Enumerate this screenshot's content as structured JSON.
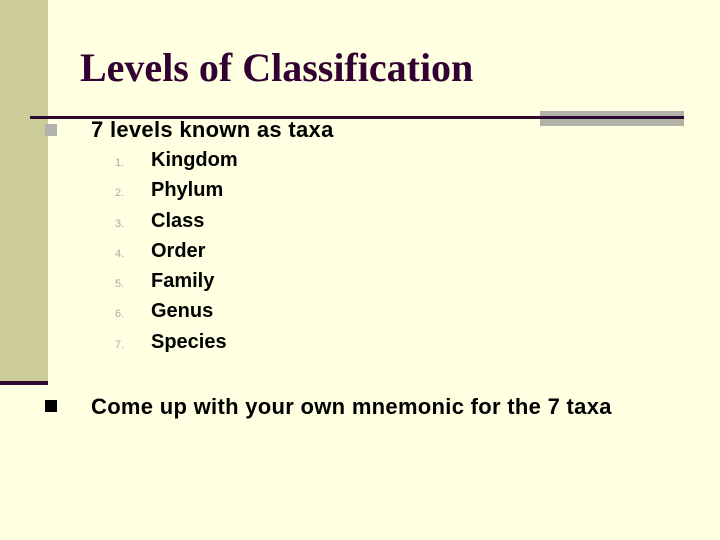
{
  "slide": {
    "title": "Levels of Classification",
    "bullets": [
      {
        "text": "7 levels known as taxa",
        "sub_items": [
          {
            "number": "1.",
            "text": "Kingdom"
          },
          {
            "number": "2.",
            "text": "Phylum"
          },
          {
            "number": "3.",
            "text": "Class"
          },
          {
            "number": "4.",
            "text": "Order"
          },
          {
            "number": "5.",
            "text": "Family"
          },
          {
            "number": "6.",
            "text": "Genus"
          },
          {
            "number": "7.",
            "text": "Species"
          }
        ]
      },
      {
        "text": "Come up with your own mnemonic for the 7 taxa"
      }
    ]
  },
  "colors": {
    "background": "#FFFFE1",
    "sidebar": "#CCCC99",
    "title": "#330033",
    "rule": "#2E0A2E"
  }
}
